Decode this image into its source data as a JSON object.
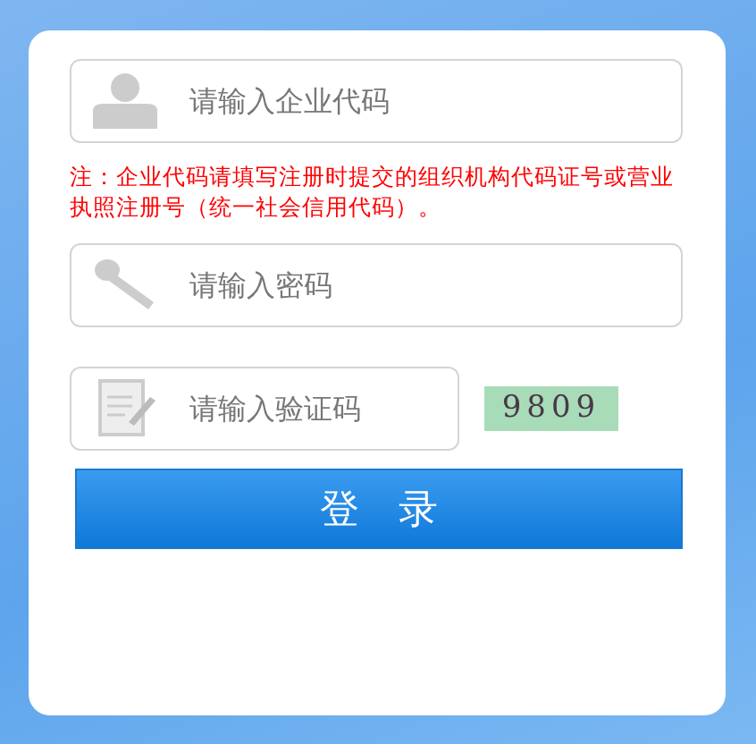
{
  "fields": [
    {
      "kind": "user",
      "placeholder": "请输入企业代码"
    }
  ],
  "note": "注：企业代码请填写注册时提交的组织机构代码证号或营业执照注册号（统一社会信用代码）。",
  "password": {
    "kind": "key",
    "placeholder": "请输入密码"
  },
  "captcha": {
    "kind": "form",
    "placeholder": "请输入验证码",
    "code": "9809"
  },
  "login_button": "登　录"
}
